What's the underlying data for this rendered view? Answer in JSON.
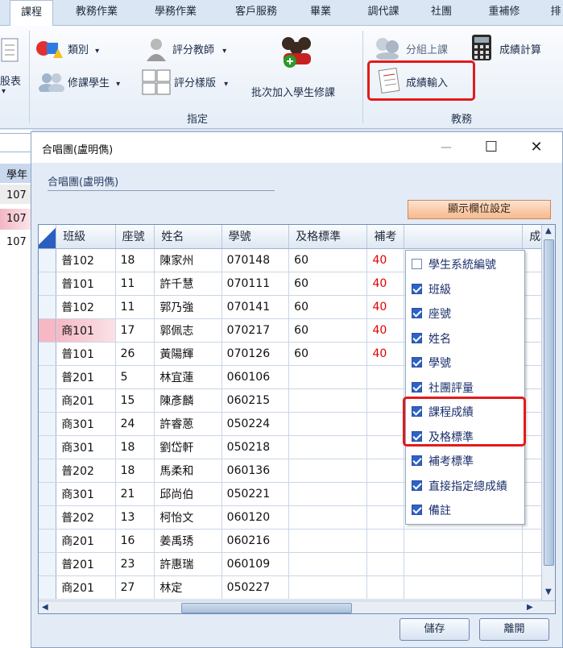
{
  "tabs": [
    "課程",
    "教務作業",
    "學務作業",
    "客戶服務",
    "畢業",
    "調代課",
    "社團",
    "重補修",
    "排"
  ],
  "ribbon": {
    "left_cut_label": "股表",
    "category": "類別",
    "assign_teacher": "評分教師",
    "enroll_students": "修課學生",
    "grading_template": "評分樣版",
    "batch_add": "批次加入學生修課",
    "group_label_setting": "指定",
    "group_class": "分組上課",
    "grade_calc": "成績計算",
    "grade_input": "成績輸入",
    "group_label_academic": "教務",
    "dropdown_glyph": "▾"
  },
  "left_panel": {
    "header": "學年",
    "rows": [
      "107",
      "107",
      "107"
    ]
  },
  "dialog": {
    "title": "合唱團(盧明儁)",
    "minimize": "—",
    "maximize": "☐",
    "close": "✕",
    "course_label": "合唱團(盧明儁)",
    "show_columns_button": "顯示欄位設定",
    "save_button": "儲存",
    "leave_button": "離開"
  },
  "grid": {
    "columns": [
      "班級",
      "座號",
      "姓名",
      "學號",
      "及格標準",
      "補考",
      "",
      "成"
    ],
    "rows": [
      {
        "cls": "普102",
        "seat": "18",
        "name": "陳家州",
        "sid": "070148",
        "pass": "60",
        "makeup": "40"
      },
      {
        "cls": "普101",
        "seat": "11",
        "name": "許千慧",
        "sid": "070111",
        "pass": "60",
        "makeup": "40"
      },
      {
        "cls": "普102",
        "seat": "11",
        "name": "郭乃強",
        "sid": "070141",
        "pass": "60",
        "makeup": "40"
      },
      {
        "cls": "商101",
        "seat": "17",
        "name": "郭佩志",
        "sid": "070217",
        "pass": "60",
        "makeup": "40"
      },
      {
        "cls": "普101",
        "seat": "26",
        "name": "黃陽輝",
        "sid": "070126",
        "pass": "60",
        "makeup": "40"
      },
      {
        "cls": "普201",
        "seat": "5",
        "name": "林宜蓮",
        "sid": "060106",
        "pass": "",
        "makeup": ""
      },
      {
        "cls": "商201",
        "seat": "15",
        "name": "陳彥麟",
        "sid": "060215",
        "pass": "",
        "makeup": ""
      },
      {
        "cls": "商301",
        "seat": "24",
        "name": "許睿蒽",
        "sid": "050224",
        "pass": "",
        "makeup": ""
      },
      {
        "cls": "商301",
        "seat": "18",
        "name": "劉岱軒",
        "sid": "050218",
        "pass": "",
        "makeup": ""
      },
      {
        "cls": "普202",
        "seat": "18",
        "name": "馬柔和",
        "sid": "060136",
        "pass": "",
        "makeup": ""
      },
      {
        "cls": "商301",
        "seat": "21",
        "name": "邱尚伯",
        "sid": "050221",
        "pass": "",
        "makeup": ""
      },
      {
        "cls": "普202",
        "seat": "13",
        "name": "柯怡文",
        "sid": "060120",
        "pass": "",
        "makeup": ""
      },
      {
        "cls": "商201",
        "seat": "16",
        "name": "姜禹琇",
        "sid": "060216",
        "pass": "",
        "makeup": ""
      },
      {
        "cls": "普201",
        "seat": "23",
        "name": "許惠瑞",
        "sid": "060109",
        "pass": "",
        "makeup": ""
      },
      {
        "cls": "商201",
        "seat": "27",
        "name": "林定",
        "sid": "050227",
        "pass": "",
        "makeup": ""
      }
    ]
  },
  "column_menu": [
    {
      "label": "學生系統編號",
      "checked": false
    },
    {
      "label": "班級",
      "checked": true
    },
    {
      "label": "座號",
      "checked": true
    },
    {
      "label": "姓名",
      "checked": true
    },
    {
      "label": "學號",
      "checked": true
    },
    {
      "label": "社團評量",
      "checked": true
    },
    {
      "label": "課程成績",
      "checked": true
    },
    {
      "label": "及格標準",
      "checked": true
    },
    {
      "label": "補考標準",
      "checked": true
    },
    {
      "label": "直接指定總成績",
      "checked": true
    },
    {
      "label": "備註",
      "checked": true
    }
  ],
  "colors": {
    "highlight": "#e21b1b",
    "makeup_value": "#e00000",
    "selected_row": "#f5b8c4"
  }
}
